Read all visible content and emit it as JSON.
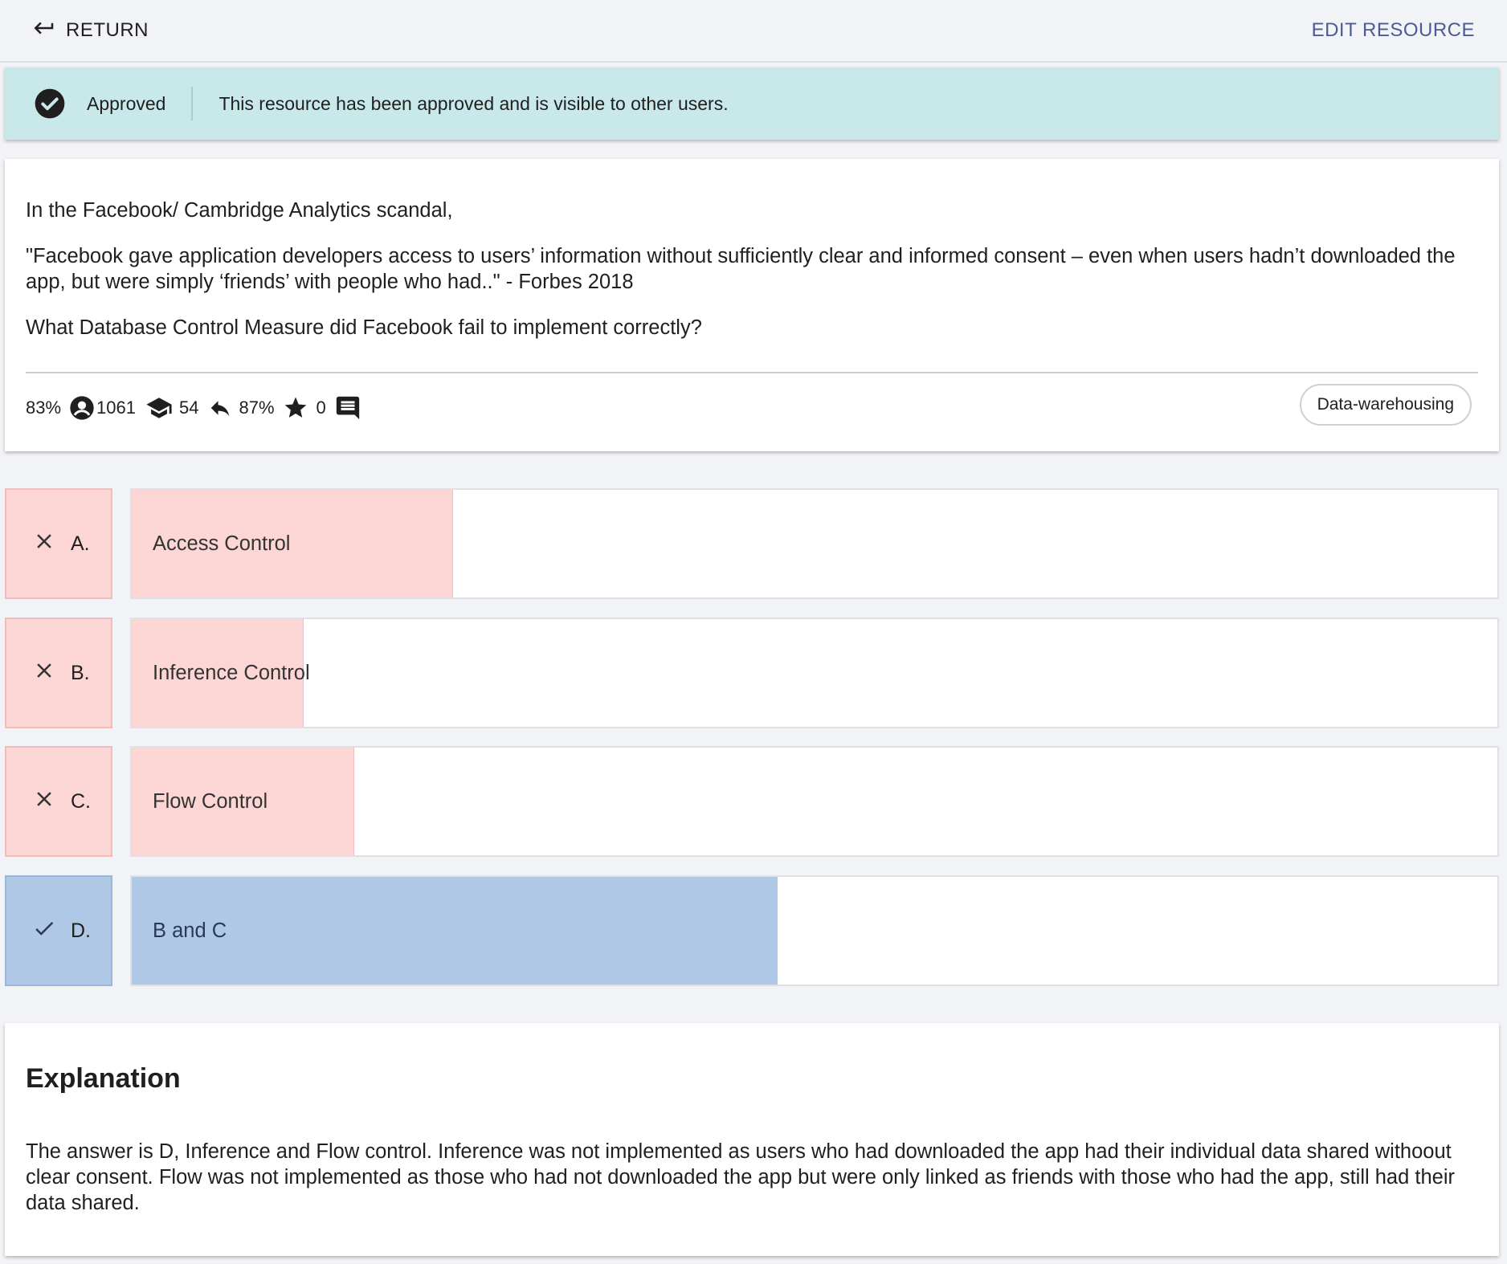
{
  "topbar": {
    "return_label": "RETURN",
    "edit_label": "EDIT RESOURCE"
  },
  "banner": {
    "status": "Approved",
    "message": "This resource has been approved and is visible to other users.",
    "icon": "check-circle-icon"
  },
  "question": {
    "paragraphs": [
      "In the Facebook/ Cambridge Analytics scandal,",
      "\"Facebook gave application developers access to users’ information without sufficiently clear and informed consent – even when users hadn’t downloaded the app, but were simply ‘friends’ with people who had..\" - Forbes 2018",
      "What Database Control Measure did Facebook fail to implement correctly?"
    ],
    "stats": {
      "correct_pct": "83%",
      "responses": "1061",
      "difficulty": "54",
      "reply_pct": "87%",
      "stars": "0"
    },
    "tag": "Data-warehousing"
  },
  "answers": [
    {
      "letter": "A.",
      "text": "Access Control",
      "correct": false,
      "share": 0.235
    },
    {
      "letter": "B.",
      "text": "Inference Control",
      "correct": false,
      "share": 0.126
    },
    {
      "letter": "C.",
      "text": "Flow Control",
      "correct": false,
      "share": 0.163
    },
    {
      "letter": "D.",
      "text": "B and C",
      "correct": true,
      "share": 0.473
    }
  ],
  "explanation": {
    "title": "Explanation",
    "text": "The answer is D, Inference and Flow control. Inference was not implemented as users who had downloaded the app had their individual data shared withoout clear consent. Flow was not implemented as those who had not downloaded the app but were only linked as friends with those who had the app, still had their data shared."
  },
  "colors": {
    "banner_bg": "#c8e8ea",
    "wrong_fill": "#fbd6d5",
    "correct_fill": "#aec8e6",
    "accent": "#4b5b96"
  }
}
